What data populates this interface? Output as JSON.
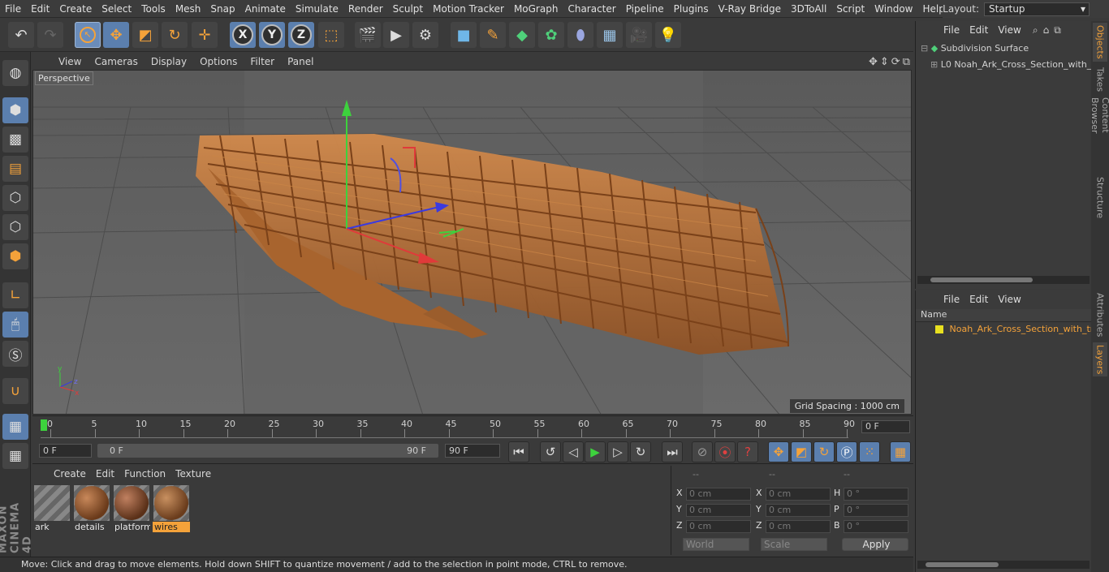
{
  "menu": [
    "File",
    "Edit",
    "Create",
    "Select",
    "Tools",
    "Mesh",
    "Snap",
    "Animate",
    "Simulate",
    "Render",
    "Sculpt",
    "Motion Tracker",
    "MoGraph",
    "Character",
    "Pipeline",
    "Plugins",
    "V-Ray Bridge",
    "3DToAll",
    "Script",
    "Window",
    "Help"
  ],
  "layout": {
    "label": "Layout:",
    "value": "Startup"
  },
  "toolbar": {
    "axis_x": "X",
    "axis_y": "Y",
    "axis_z": "Z"
  },
  "viewport": {
    "menu": [
      "View",
      "Cameras",
      "Display",
      "Options",
      "Filter",
      "Panel"
    ],
    "label": "Perspective",
    "grid_spacing": "Grid Spacing : 1000 cm"
  },
  "timeline": {
    "ticks": [
      "0",
      "5",
      "10",
      "15",
      "20",
      "25",
      "30",
      "35",
      "40",
      "45",
      "50",
      "55",
      "60",
      "65",
      "70",
      "75",
      "80",
      "85",
      "90"
    ],
    "current_frame": "0 F",
    "start": "0 F",
    "range_left": "0 F",
    "range_right": "90 F",
    "end": "90 F"
  },
  "materials": {
    "menu": [
      "Create",
      "Edit",
      "Function",
      "Texture"
    ],
    "items": [
      {
        "name": "ark",
        "selected": false
      },
      {
        "name": "details",
        "selected": false
      },
      {
        "name": "platform",
        "selected": false
      },
      {
        "name": "wires",
        "selected": true
      }
    ]
  },
  "coordinates": {
    "headers": [
      "--",
      "--",
      "--"
    ],
    "rows": [
      {
        "l1": "X",
        "v1": "0 cm",
        "l2": "X",
        "v2": "0 cm",
        "l3": "H",
        "v3": "0 °"
      },
      {
        "l1": "Y",
        "v1": "0 cm",
        "l2": "Y",
        "v2": "0 cm",
        "l3": "P",
        "v3": "0 °"
      },
      {
        "l1": "Z",
        "v1": "0 cm",
        "l2": "Z",
        "v2": "0 cm",
        "l3": "B",
        "v3": "0 °"
      }
    ],
    "mode1": "World",
    "mode2": "Scale",
    "apply": "Apply"
  },
  "objects": {
    "menu": [
      "File",
      "Edit",
      "View"
    ],
    "items": [
      "Subdivision Surface",
      "Noah_Ark_Cross_Section_with_tr"
    ]
  },
  "layers": {
    "menu": [
      "File",
      "Edit",
      "View"
    ],
    "column": "Name",
    "items": [
      "Noah_Ark_Cross_Section_with_tra"
    ]
  },
  "side_tabs": [
    "Objects",
    "Takes",
    "Content Browser",
    "Structure",
    "Attributes",
    "Layers"
  ],
  "branding": "MAXON CINEMA 4D",
  "status": "Move: Click and drag to move elements. Hold down SHIFT to quantize movement / add to the selection in point mode, CTRL to remove.",
  "colors": {
    "accent": "#f4a23a",
    "selection": "#5b7fae",
    "wood": "#b8723a"
  }
}
